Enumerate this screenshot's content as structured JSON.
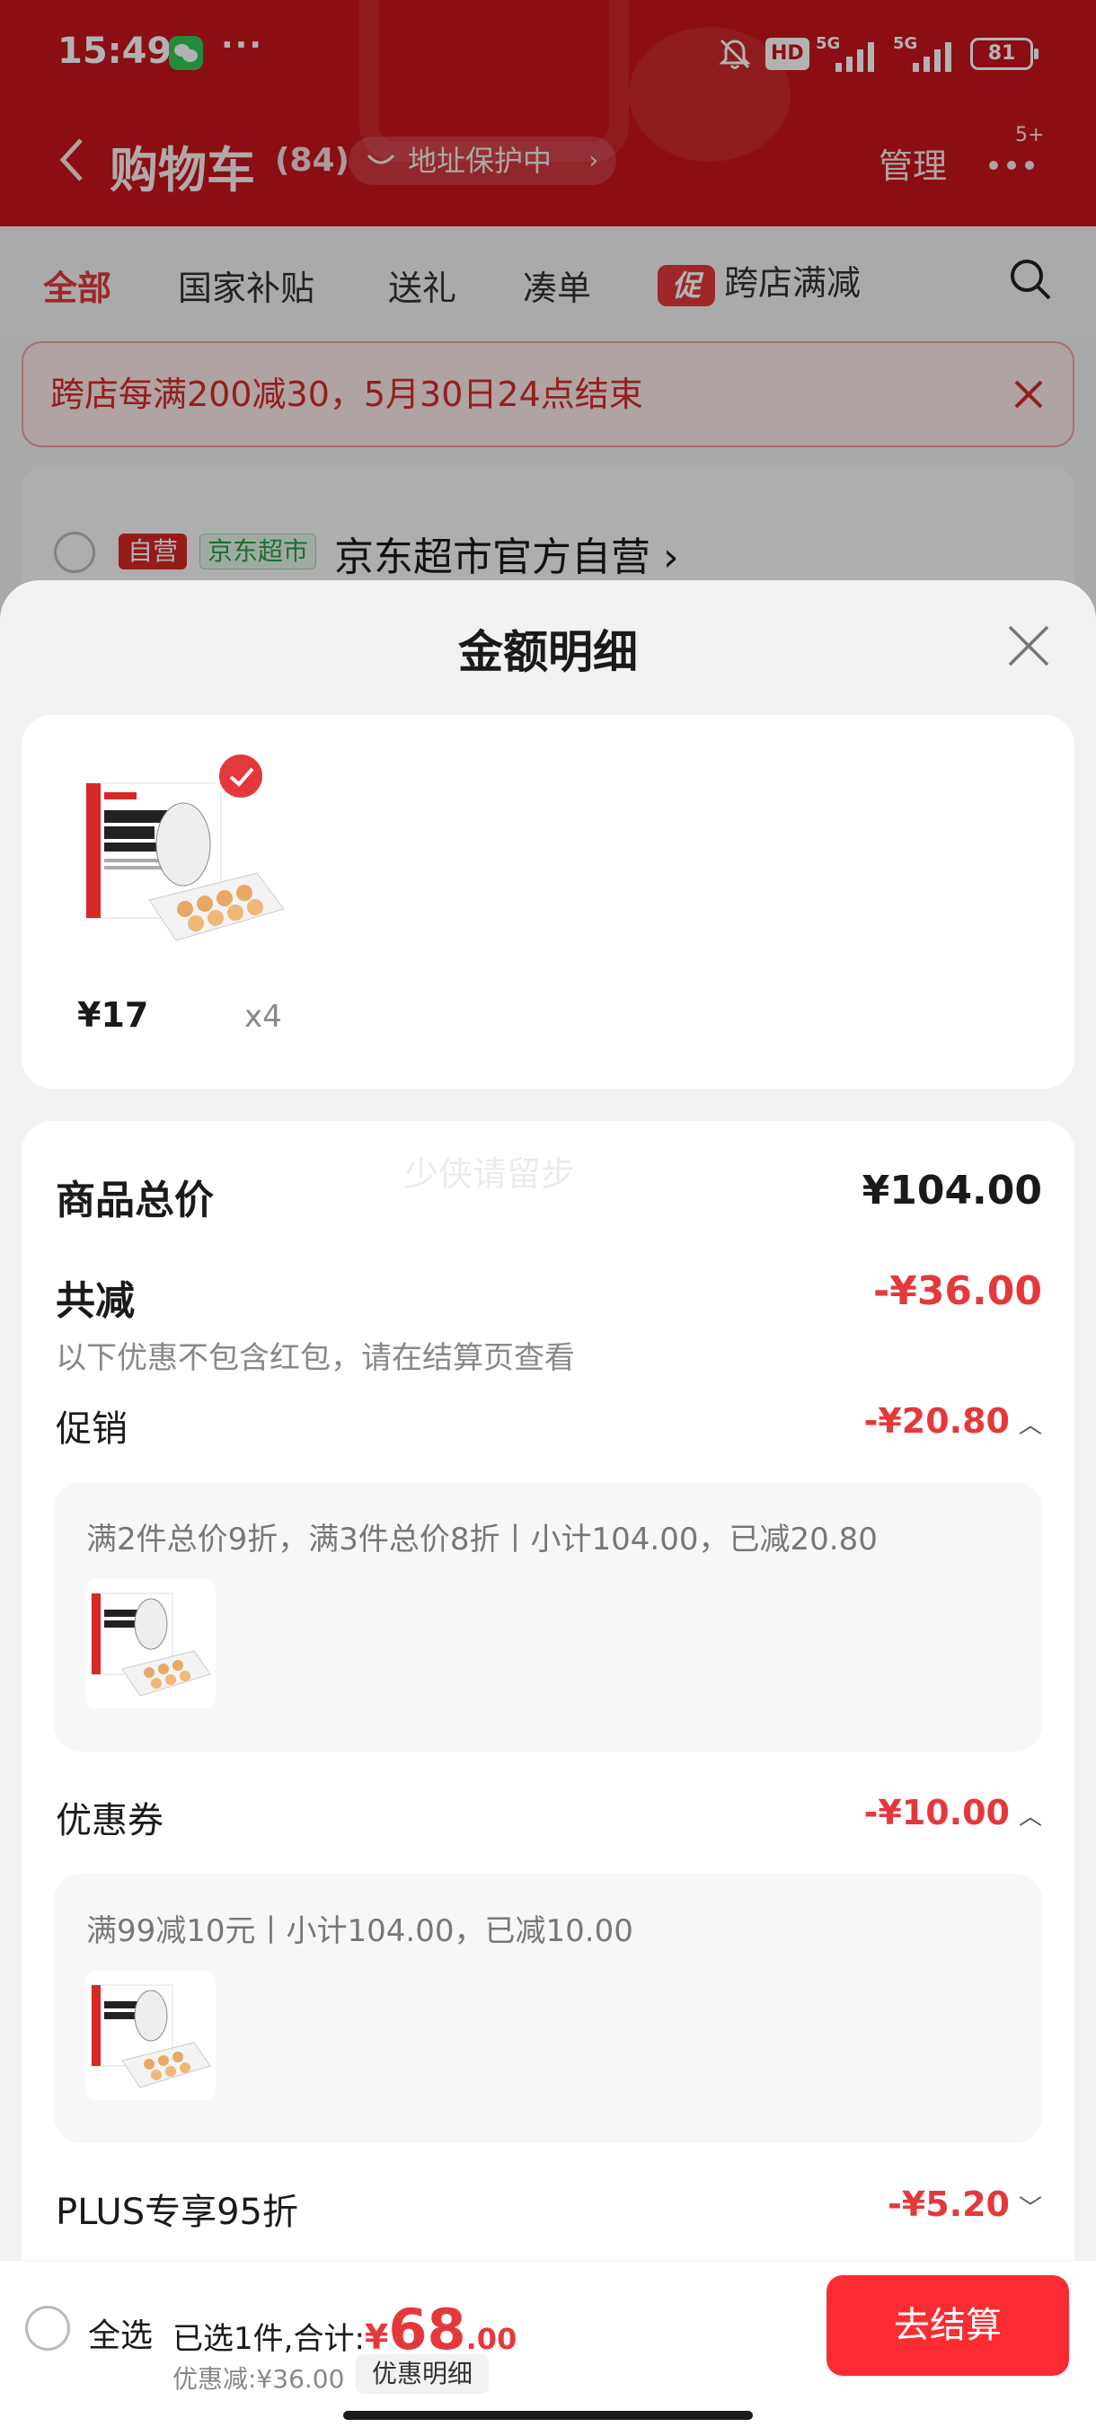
{
  "status_bar": {
    "time": "15:49",
    "hd": "HD",
    "net1": "5G",
    "net2": "5G",
    "battery": "81"
  },
  "cart_header": {
    "title": "购物车",
    "count": "(84)",
    "address_protect": "地址保护中",
    "manage": "管理",
    "more_badge": "5+"
  },
  "tabs": [
    {
      "label": "全部"
    },
    {
      "label": "国家补贴"
    },
    {
      "label": "送礼"
    },
    {
      "label": "凑单"
    },
    {
      "label": "跨店满减",
      "badge": "促"
    }
  ],
  "promo_banner": {
    "text": "跨店每满200减30，5月30日24点结束"
  },
  "store": {
    "tag_self": "自营",
    "tag_market": "京东超市",
    "name": "京东超市官方自营"
  },
  "sheet": {
    "title": "金额明细",
    "product": {
      "price": "¥17",
      "qty": "x4"
    },
    "watermark": "少侠请留步",
    "total_label": "商品总价",
    "total_value": "¥104.00",
    "reduce_label": "共减",
    "reduce_value": "-¥36.00",
    "reduce_note": "以下优惠不包含红包，请在结算页查看",
    "promotion": {
      "label": "促销",
      "value": "-¥20.80",
      "desc": "满2件总价9折，满3件总价8折丨小计104.00，已减20.80"
    },
    "coupon": {
      "label": "优惠券",
      "value": "-¥10.00",
      "desc": "满99减10元丨小计104.00，已减10.00"
    },
    "plus": {
      "label": "PLUS专享95折",
      "value": "-¥5.20"
    }
  },
  "bottom_bar": {
    "select_all": "全选",
    "summary_prefix": "已选1件,合计:",
    "currency": "¥",
    "amount_int": "68",
    "amount_dec": ".00",
    "discount": "优惠减:¥36.00",
    "detail_button": "优惠明细",
    "checkout": "去结算"
  },
  "colors": {
    "brand_red": "#e4393c",
    "header_red": "#c8151e",
    "checkout_red": "#fa2c31"
  }
}
